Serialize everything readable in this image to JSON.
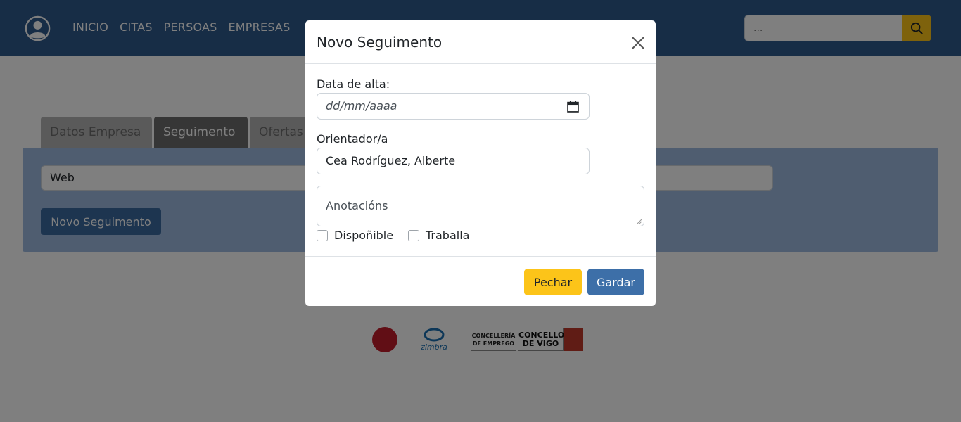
{
  "navbar": {
    "links": [
      "INICIO",
      "CITAS",
      "PERSOAS",
      "EMPRESAS"
    ],
    "search_placeholder": "..."
  },
  "tabs": [
    {
      "label": "Datos Empresa",
      "active": false
    },
    {
      "label": "Seguimento",
      "active": true
    },
    {
      "label": "Ofertas",
      "active": false
    }
  ],
  "panel": {
    "web_value": "Web",
    "novo_button": "Novo Seguimento"
  },
  "footer": {
    "logo_concelleria": "CONCELLERÍA DE EMPREGO",
    "logo_concello": "CONCELLO DE VIGO",
    "logo_zimbra": "zimbra"
  },
  "modal": {
    "title": "Novo Seguimento",
    "date_label": "Data de alta:",
    "date_placeholder": "dd/mm/aaaa",
    "orientador_label": "Orientador/a",
    "orientador_value": "Cea Rodríguez, Alberte",
    "anotacions_placeholder": "Anotacións",
    "checkbox_disponible": "Dispoñible",
    "checkbox_traballa": "Traballa",
    "btn_close": "Pechar",
    "btn_save": "Gardar"
  },
  "colors": {
    "navbar": "#2f5a8c",
    "accent_yellow": "#fcc419",
    "primary_blue": "#3d6fa8"
  }
}
